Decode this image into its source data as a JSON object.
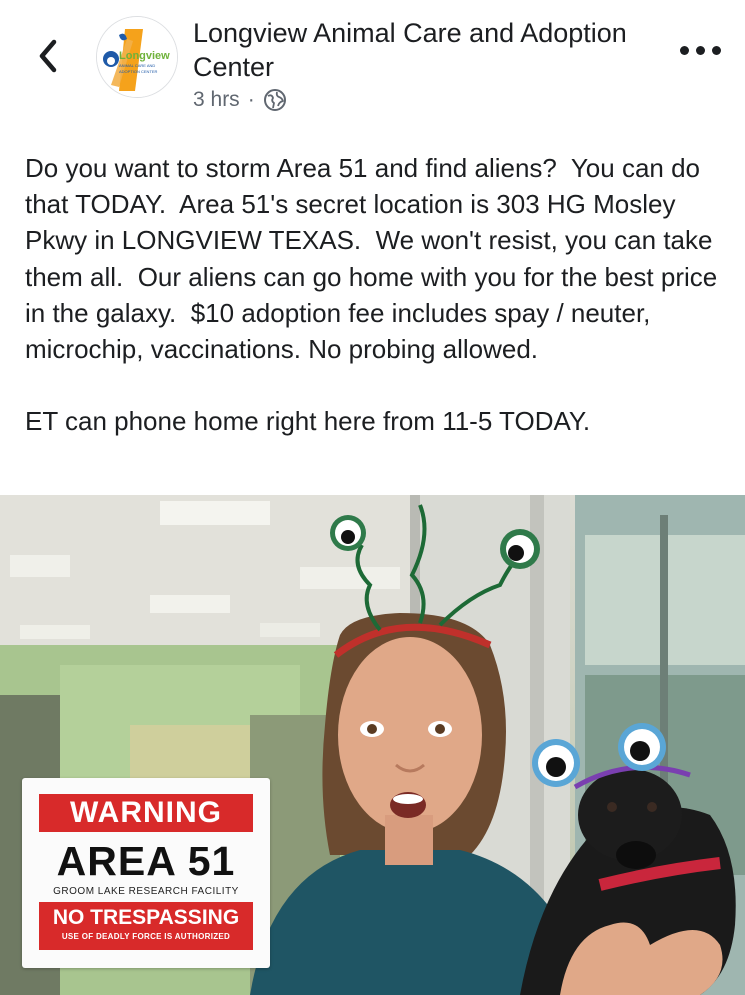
{
  "header": {
    "page_name": "Longview Animal Care and Adoption Center",
    "timestamp": "3 hrs",
    "separator": "·",
    "avatar_logo_text": "Longview",
    "avatar_logo_subtext": "ANIMAL CARE AND ADOPTION CENTER",
    "icons": {
      "back": "chevron-left-icon",
      "privacy": "globe-icon",
      "more": "more-dots-icon"
    }
  },
  "post": {
    "paragraph_1": "Do you want to storm Area 51 and find aliens?  You can do that TODAY.  Area 51's secret location is 303 HG Mosley Pkwy in LONGVIEW TEXAS.  We won't resist, you can take them all.  Our aliens can go home with you for the best price in the galaxy.  $10 adoption fee includes spay / neuter, microchip, vaccinations. No probing allowed.",
    "paragraph_2": "ET can phone home right here from 11-5 TODAY."
  },
  "photo": {
    "sign": {
      "warning": "WARNING",
      "area": "AREA 51",
      "facility": "GROOM LAKE RESEARCH FACILITY",
      "no_trespassing": "NO TRESPASSING",
      "deadly_force": "USE OF DEADLY FORCE IS AUTHORIZED"
    }
  },
  "colors": {
    "text": "#1c1e21",
    "meta_text": "#606770",
    "sign_red": "#d82a2a",
    "logo_orange": "#f5a21b",
    "logo_green": "#6fb23a",
    "logo_blue": "#1f5aa8"
  }
}
